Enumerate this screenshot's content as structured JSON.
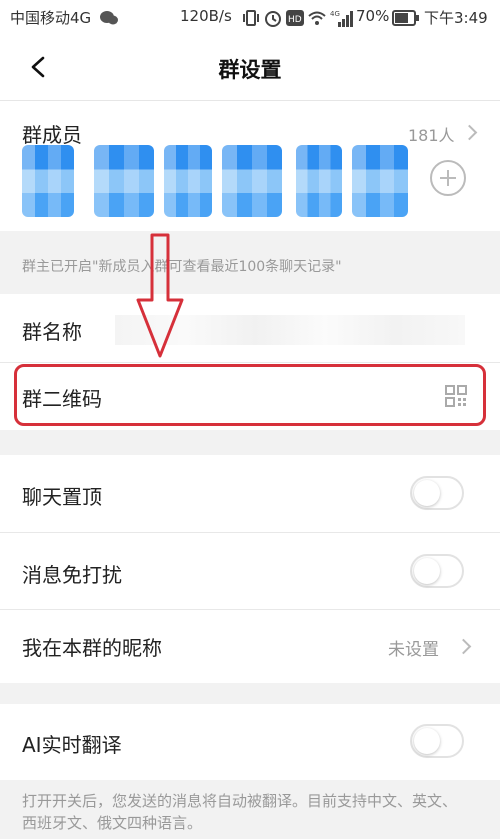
{
  "status_bar": {
    "carrier": "中国移动4G",
    "network_speed": "120B/s",
    "battery_percent": "70%",
    "time": "下午3:49",
    "icons": [
      "wechat-icon",
      "vibrate-icon",
      "alarm-icon",
      "hd-icon",
      "wifi-icon",
      "4g-signal-icon",
      "battery-icon"
    ]
  },
  "header": {
    "title": "群设置"
  },
  "members": {
    "label": "群成员",
    "count": "181人"
  },
  "notice": "群主已开启\"新成员入群可查看最近100条聊天记录\"",
  "group_name": {
    "label": "群名称"
  },
  "qr_code": {
    "label": "群二维码",
    "icon": "qr-code-icon"
  },
  "pin_chat": {
    "label": "聊天置顶",
    "enabled": false
  },
  "mute": {
    "label": "消息免打扰",
    "enabled": false
  },
  "nickname": {
    "label": "我在本群的昵称",
    "value": "未设置"
  },
  "ai_translate": {
    "label": "AI实时翻译",
    "enabled": false
  },
  "footer_note": "打开开关后，您发送的消息将自动被翻译。目前支持中文、英文、西班牙文、俄文四种语言。",
  "annotation": {
    "color": "#d6303a"
  }
}
